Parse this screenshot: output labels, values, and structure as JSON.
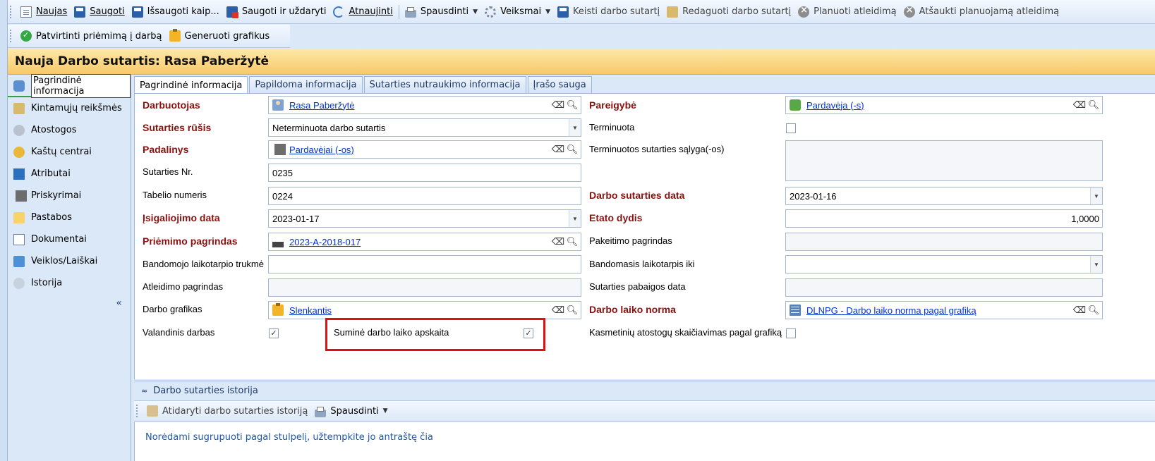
{
  "toolbar": {
    "new": "Naujas",
    "save": "Saugoti",
    "save_as": "Išsaugoti kaip...",
    "save_close": "Saugoti ir uždaryti",
    "refresh": "Atnaujinti",
    "print": "Spausdinti",
    "actions": "Veiksmai",
    "change_contract": "Keisti darbo sutartį",
    "edit_contract": "Redaguoti darbo sutartį",
    "plan_dismissal": "Planuoti atleidimą",
    "cancel_dismissal": "Atšaukti planuojamą atleidimą"
  },
  "toolbar2": {
    "confirm_hiring": "Patvirtinti priėmimą į darbą",
    "generate_schedules": "Generuoti grafikus"
  },
  "title": "Nauja Darbo sutartis: Rasa Paberžytė",
  "nav": {
    "items": [
      {
        "label": "Pagrindinė informacija"
      },
      {
        "label": "Kintamųjų reikšmės"
      },
      {
        "label": "Atostogos"
      },
      {
        "label": "Kaštų centrai"
      },
      {
        "label": "Atributai"
      },
      {
        "label": "Priskyrimai"
      },
      {
        "label": "Pastabos"
      },
      {
        "label": "Dokumentai"
      },
      {
        "label": "Veiklos/Laiškai"
      },
      {
        "label": "Istorija"
      }
    ],
    "collapse": "«"
  },
  "tabs": [
    "Pagrindinė informacija",
    "Papildoma informacija",
    "Sutarties nutraukimo informacija",
    "Įrašo sauga"
  ],
  "form": {
    "employee_label": "Darbuotojas",
    "employee_value": "Rasa Paberžytė",
    "contract_type_label": "Sutarties rūšis",
    "contract_type_value": "Neterminuota darbo sutartis",
    "department_label": "Padalinys",
    "department_value": "Pardavėjai (-os)",
    "contract_no_label": "Sutarties Nr.",
    "contract_no_value": "0235",
    "tab_no_label": "Tabelio numeris",
    "tab_no_value": "0224",
    "effective_date_label": "Įsigaliojimo data",
    "effective_date_value": "2023-01-17",
    "hiring_basis_label": "Priėmimo pagrindas",
    "hiring_basis_value": "2023-A-2018-017",
    "probation_label": "Bandomojo laikotarpio trukmė",
    "probation_value": "",
    "dismissal_basis_label": "Atleidimo pagrindas",
    "schedule_label": "Darbo grafikas",
    "schedule_value": "Slenkantis",
    "hourly_label": "Valandinis darbas",
    "cumulative_label": "Suminė darbo laiko apskaita",
    "position_label": "Pareigybė",
    "position_value": "Pardavėja (-s)",
    "fixed_term_label": "Terminuota",
    "fixed_term_cond_label": "Terminuotos sutarties sąlyga(-os)",
    "contract_date_label": "Darbo sutarties data",
    "contract_date_value": "2023-01-16",
    "fte_label": "Etato dydis",
    "fte_value": "1,0000",
    "change_basis_label": "Pakeitimo pagrindas",
    "probation_until_label": "Bandomasis laikotarpis iki",
    "end_date_label": "Sutarties pabaigos data",
    "time_norm_label": "Darbo laiko norma",
    "time_norm_value": "DLNPG - Darbo laiko norma pagal grafiką",
    "annual_leave_label": "Kasmetinių atostogų skaičiavimas pagal grafiką",
    "hourly_checked": true,
    "cumulative_checked": true,
    "fixed_term_checked": false,
    "annual_leave_checked": false
  },
  "history": {
    "header": "Darbo sutarties istorija",
    "open": "Atidaryti darbo sutarties istoriją",
    "print": "Spausdinti",
    "group_hint": "Norėdami sugrupuoti pagal stulpelį, užtempkite jo antraštę čia"
  },
  "icons": {
    "new": "document-icon",
    "save": "floppy-icon",
    "refresh": "refresh-icon",
    "print": "printer-icon",
    "actions": "gear-icon",
    "edit": "eraser-icon",
    "lookup": "magnifier-icon"
  },
  "colors": {
    "required_label": "#8b1010",
    "title_bar": "#f8c96a",
    "highlight_box": "#e01010",
    "link": "#0033cc"
  }
}
